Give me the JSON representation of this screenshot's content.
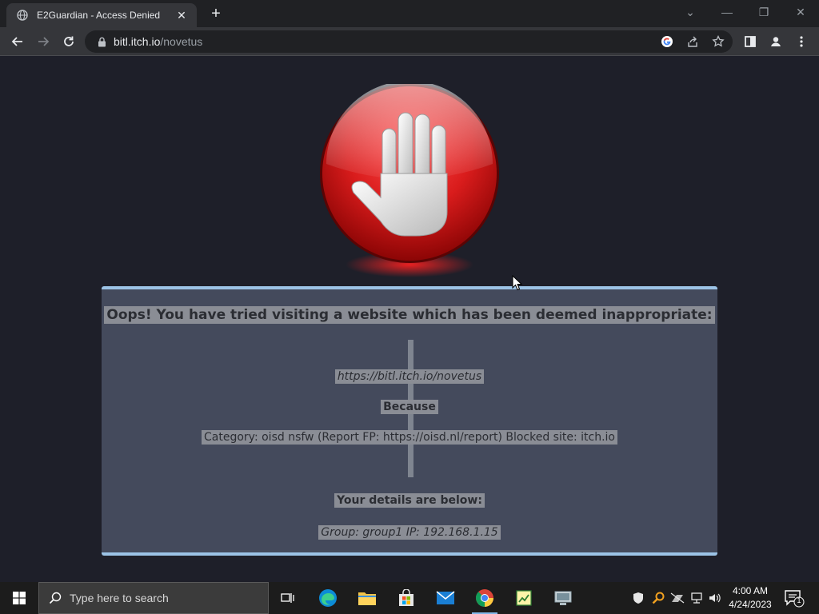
{
  "browser": {
    "tab": {
      "title": "E2Guardian - Access Denied",
      "close": "✕"
    },
    "new_tab": "+",
    "window_controls": {
      "dropdown": "⌄",
      "minimize": "—",
      "restore": "❐",
      "close": "✕"
    },
    "url": {
      "host": "bitl.itch.io",
      "path": "/novetus"
    }
  },
  "page": {
    "heading": "Oops! You have tried visiting a website which has been deemed inappropriate:",
    "blocked_url": "https://bitl.itch.io/novetus",
    "because": "Because",
    "reason": "Category: oisd nsfw (Report FP: https://oisd.nl/report)   Blocked site: itch.io",
    "details_heading": "Your details are below:",
    "details": "Group: group1   IP: 192.168.1.15"
  },
  "taskbar": {
    "search_placeholder": "Type here to search",
    "time": "4:00 AM",
    "date": "4/24/2023",
    "notification_count": "1"
  },
  "colors": {
    "panel_bg": "#444a5c",
    "panel_border": "#9cc3e6",
    "stop_red": "#d91c1c",
    "page_bg": "#1e1f29"
  }
}
